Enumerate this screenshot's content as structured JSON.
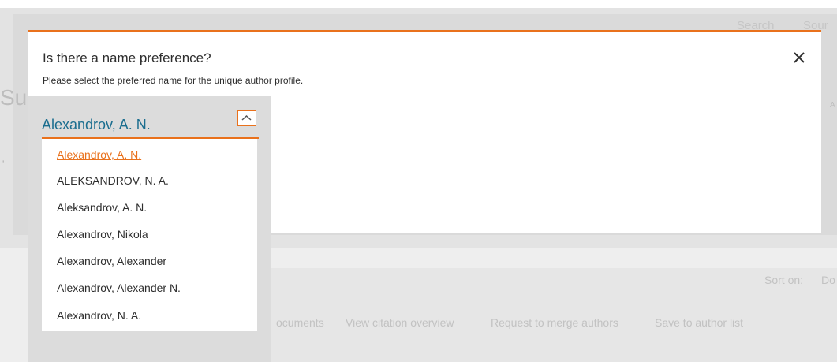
{
  "background": {
    "top_nav": [
      "Search",
      "Sour"
    ],
    "left_fragment": "Su",
    "right_fragment": "A",
    "sort_label": "Sort on:",
    "sort_value": "Do",
    "actions": [
      "ocuments",
      "View citation overview",
      "Request to merge authors",
      "Save to author list"
    ]
  },
  "modal": {
    "title": "Is there a name preference?",
    "subtitle": "Please select the preferred name for the unique author profile.",
    "close_icon": "close-icon",
    "accent_color": "#e9711c"
  },
  "name_select": {
    "selected_value": "Alexandrov, A. N.",
    "toggle_icon": "chevron-up-icon",
    "value_color": "#1b6e8f",
    "options": [
      "Alexandrov, A. N.",
      "ALEKSANDROV, N. A.",
      "Aleksandrov, A. N.",
      "Alexandrov, Nikola",
      "Alexandrov, Alexander",
      "Alexandrov, Alexander N.",
      "Alexandrov, N. A."
    ]
  }
}
